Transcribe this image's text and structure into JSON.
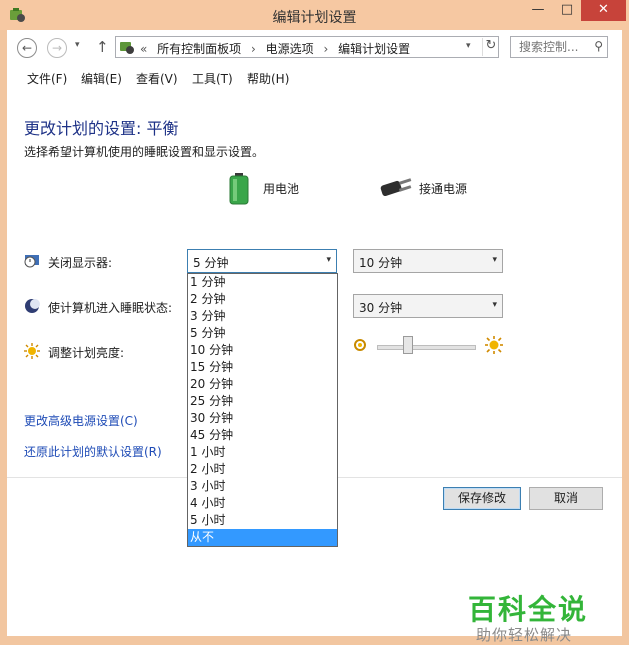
{
  "window": {
    "title": "编辑计划设置",
    "min_glyph": "—",
    "max_glyph": "□",
    "close_glyph": "✕"
  },
  "address": {
    "back_glyph": "←",
    "forward_glyph": "→",
    "up_glyph": "↑",
    "dropdown_glyph": "▾",
    "breadcrumb_prefix": "«",
    "breadcrumbs": [
      "所有控制面板项",
      "电源选项",
      "编辑计划设置"
    ],
    "separator": "›",
    "refresh_glyph": "↻",
    "search_placeholder": "搜索控制...",
    "search_glyph": "⚲"
  },
  "menu": {
    "items": [
      "文件(F)",
      "编辑(E)",
      "查看(V)",
      "工具(T)",
      "帮助(H)"
    ]
  },
  "content": {
    "heading": "更改计划的设置: 平衡",
    "subheading": "选择希望计算机使用的睡眠设置和显示设置。",
    "col_battery": "用电池",
    "col_plugged": "接通电源",
    "rows": {
      "display_label": "关闭显示器:",
      "sleep_label": "使计算机进入睡眠状态:",
      "brightness_label": "调整计划亮度:"
    },
    "display_battery_value": "5 分钟",
    "display_plugged_value": "10 分钟",
    "sleep_plugged_value": "30 分钟",
    "dropdown_arrow": "▾",
    "options": [
      "1 分钟",
      "2 分钟",
      "3 分钟",
      "5 分钟",
      "10 分钟",
      "15 分钟",
      "20 分钟",
      "25 分钟",
      "30 分钟",
      "45 分钟",
      "1 小时",
      "2 小时",
      "3 小时",
      "4 小时",
      "5 小时",
      "从不"
    ],
    "selected_option_index": 15,
    "brightness_level": 0.3,
    "link_advanced": "更改高级电源设置(C)",
    "link_restore": "还原此计划的默认设置(R)",
    "save_button": "保存修改",
    "cancel_button": "取消"
  },
  "watermark": {
    "title": "百科全说",
    "subtitle": "助你轻松解决"
  },
  "colors": {
    "accent": "#3399ff",
    "heading": "#1e3287",
    "link": "#1e4bb6",
    "titlebar": "#f6c8a2",
    "close": "#c7433a",
    "watermark": "#33b539"
  }
}
